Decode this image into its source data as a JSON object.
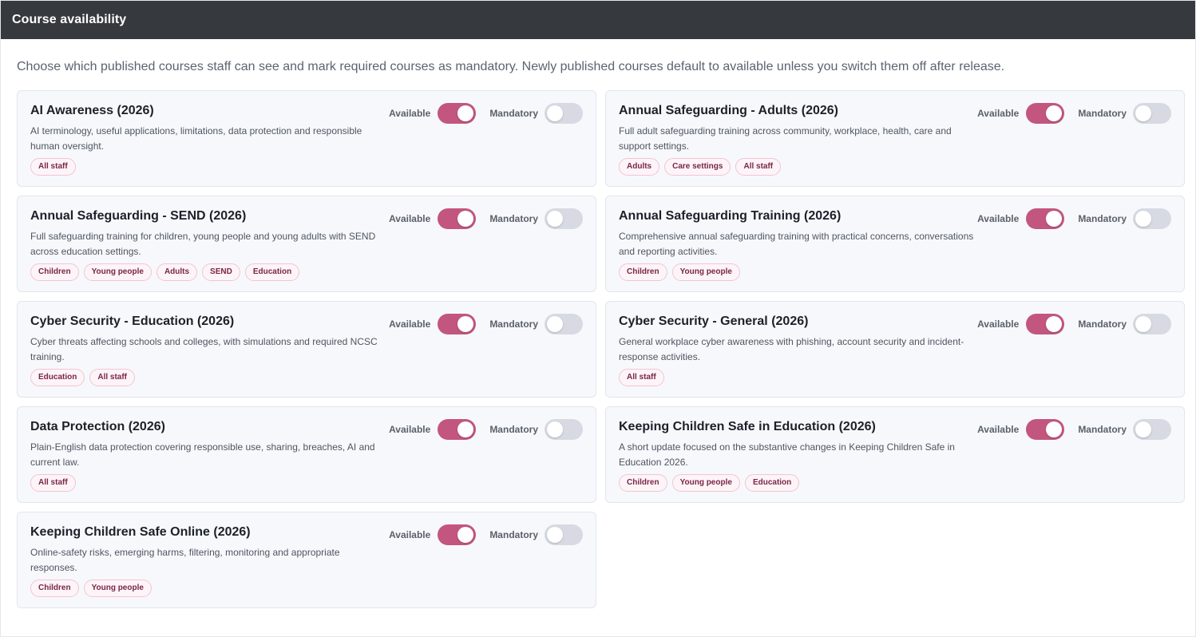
{
  "header": {
    "title": "Course availability"
  },
  "intro": "Choose which published courses staff can see and mark required courses as mandatory. Newly published courses default to available unless you switch them off after release.",
  "labels": {
    "available": "Available",
    "mandatory": "Mandatory"
  },
  "colors": {
    "header_bg": "#36393e",
    "toggle_on": "#c2567f",
    "toggle_off": "#d7dae2",
    "tag_text": "#7a2548"
  },
  "courses": [
    {
      "title": "AI Awareness (2026)",
      "description": "AI terminology, useful applications, limitations, data protection and responsible human oversight.",
      "available": true,
      "mandatory": false,
      "tags": [
        "All staff"
      ]
    },
    {
      "title": "Annual Safeguarding - Adults (2026)",
      "description": "Full adult safeguarding training across community, workplace, health, care and support settings.",
      "available": true,
      "mandatory": false,
      "tags": [
        "Adults",
        "Care settings",
        "All staff"
      ]
    },
    {
      "title": "Annual Safeguarding - SEND (2026)",
      "description": "Full safeguarding training for children, young people and young adults with SEND across education settings.",
      "available": true,
      "mandatory": false,
      "tags": [
        "Children",
        "Young people",
        "Adults",
        "SEND",
        "Education"
      ]
    },
    {
      "title": "Annual Safeguarding Training (2026)",
      "description": "Comprehensive annual safeguarding training with practical concerns, conversations and reporting activities.",
      "available": true,
      "mandatory": false,
      "tags": [
        "Children",
        "Young people"
      ]
    },
    {
      "title": "Cyber Security - Education (2026)",
      "description": "Cyber threats affecting schools and colleges, with simulations and required NCSC training.",
      "available": true,
      "mandatory": false,
      "tags": [
        "Education",
        "All staff"
      ]
    },
    {
      "title": "Cyber Security - General (2026)",
      "description": "General workplace cyber awareness with phishing, account security and incident-response activities.",
      "available": true,
      "mandatory": false,
      "tags": [
        "All staff"
      ]
    },
    {
      "title": "Data Protection (2026)",
      "description": "Plain-English data protection covering responsible use, sharing, breaches, AI and current law.",
      "available": true,
      "mandatory": false,
      "tags": [
        "All staff"
      ]
    },
    {
      "title": "Keeping Children Safe in Education (2026)",
      "description": "A short update focused on the substantive changes in Keeping Children Safe in Education 2026.",
      "available": true,
      "mandatory": false,
      "tags": [
        "Children",
        "Young people",
        "Education"
      ]
    },
    {
      "title": "Keeping Children Safe Online (2026)",
      "description": "Online-safety risks, emerging harms, filtering, monitoring and appropriate responses.",
      "available": true,
      "mandatory": false,
      "tags": [
        "Children",
        "Young people"
      ]
    }
  ]
}
